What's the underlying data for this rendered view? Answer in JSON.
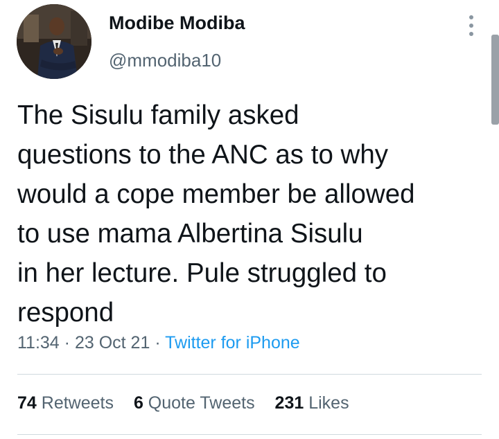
{
  "author": {
    "display_name": "Modibe Modiba",
    "handle": "@mmodiba10"
  },
  "tweet": {
    "text": "The Sisulu family  asked\nquestions to the ANC as to why\nwould a cope member be allowed\nto use mama Albertina Sisulu\nin her lecture. Pule struggled to\nrespond",
    "time": "11:34",
    "separator": "·",
    "date": "23 Oct 21",
    "source": "Twitter for iPhone"
  },
  "stats": {
    "retweets_count": "74",
    "retweets_label": "Retweets",
    "quotes_count": "6",
    "quotes_label": "Quote Tweets",
    "likes_count": "231",
    "likes_label": "Likes"
  },
  "icons": {
    "more": "more-vertical-icon"
  },
  "colors": {
    "text": "#0f1419",
    "secondary": "#536471",
    "link": "#1d9bf0",
    "divider": "#cfd9de"
  }
}
